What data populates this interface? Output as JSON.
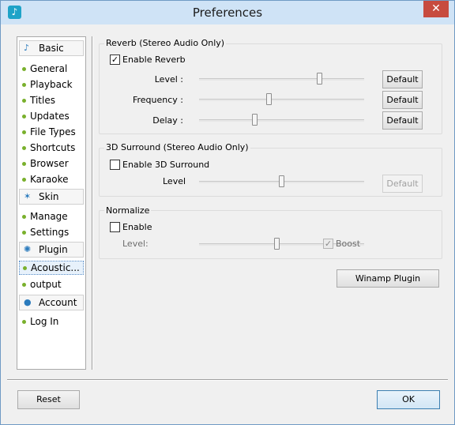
{
  "window": {
    "title": "Preferences",
    "close_glyph": "✕",
    "app_icon_glyph": "♪"
  },
  "sidebar": {
    "categories": [
      {
        "label": "Basic",
        "icon": "music-note-icon",
        "glyph": "♪"
      },
      {
        "label": "Skin",
        "icon": "magic-wand-icon",
        "glyph": "✶"
      },
      {
        "label": "Plugin",
        "icon": "gear-icon",
        "glyph": "✺"
      },
      {
        "label": "Account",
        "icon": "user-icon",
        "glyph": "●"
      }
    ],
    "basic_items": [
      "General",
      "Playback",
      "Titles",
      "Updates",
      "File Types",
      "Shortcuts",
      "Browser",
      "Karaoke"
    ],
    "skin_items": [
      "Manage",
      "Settings"
    ],
    "plugin_items": [
      "Acoustic...",
      "output"
    ],
    "account_items": [
      "Log In"
    ]
  },
  "reverb": {
    "group_title": "Reverb (Stereo Audio Only)",
    "enable_label": "Enable Reverb",
    "enabled": true,
    "level_label": "Level :",
    "frequency_label": "Frequency :",
    "delay_label": "Delay :",
    "default_label": "Default",
    "level_value": 0.74,
    "frequency_value": 0.42,
    "delay_value": 0.33
  },
  "surround": {
    "group_title": "3D Surround (Stereo Audio Only)",
    "enable_label": "Enable 3D Surround",
    "enabled": false,
    "level_label": "Level",
    "default_label": "Default",
    "level_value": 0.5
  },
  "normalize": {
    "group_title": "Normalize",
    "enable_label": "Enable",
    "enabled": false,
    "level_label": "Level:",
    "boost_label": "Boost",
    "boost_checked": true,
    "level_value": 0.47
  },
  "buttons": {
    "winamp_plugin": "Winamp Plugin",
    "reset": "Reset",
    "ok": "OK"
  },
  "check_glyph": "✓"
}
